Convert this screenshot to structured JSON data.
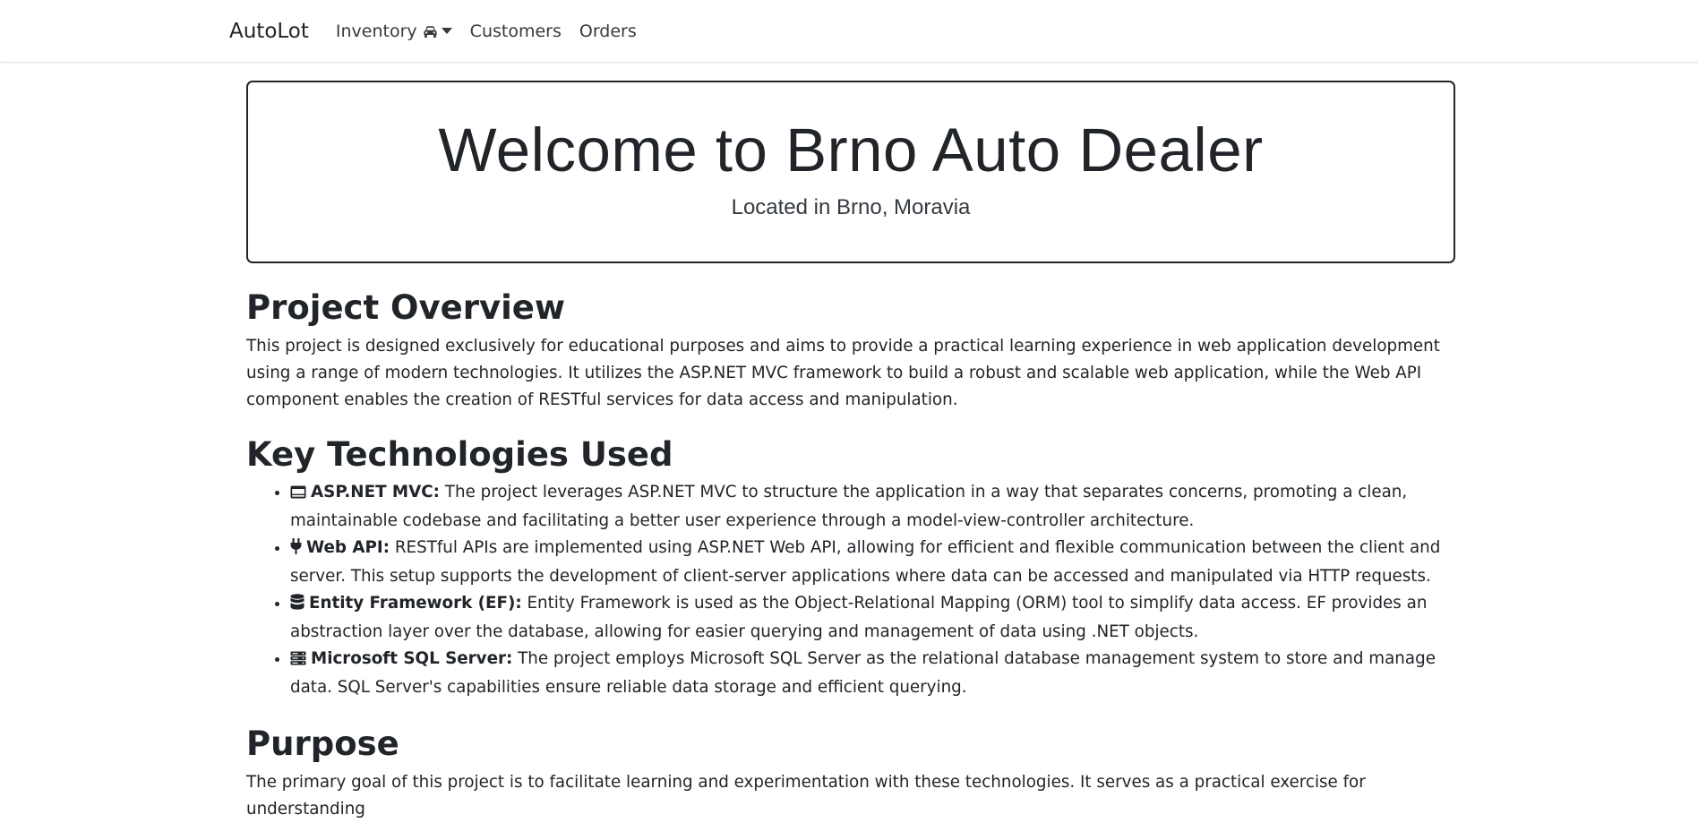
{
  "nav": {
    "brand": "AutoLot",
    "items": [
      {
        "label": "Inventory",
        "icon": "car-icon",
        "dropdown": true
      },
      {
        "label": "Customers"
      },
      {
        "label": "Orders"
      }
    ]
  },
  "hero": {
    "title": "Welcome to Brno Auto Dealer",
    "subtitle": "Located in Brno, Moravia"
  },
  "overview": {
    "heading": "Project Overview",
    "text": "This project is designed exclusively for educational purposes and aims to provide a practical learning experience in web application development using a range of modern technologies. It utilizes the ASP.NET MVC framework to build a robust and scalable web application, while the Web API component enables the creation of RESTful services for data access and manipulation."
  },
  "technologies": {
    "heading": "Key Technologies Used",
    "items": [
      {
        "icon": "window-icon",
        "title": "ASP.NET MVC:",
        "text": " The project leverages ASP.NET MVC to structure the application in a way that separates concerns, promoting a clean, maintainable codebase and facilitating a better user experience through a model-view-controller architecture."
      },
      {
        "icon": "plug-icon",
        "title": "Web API:",
        "text": " RESTful APIs are implemented using ASP.NET Web API, allowing for efficient and flexible communication between the client and server. This setup supports the development of client-server applications where data can be accessed and manipulated via HTTP requests."
      },
      {
        "icon": "database-icon",
        "title": "Entity Framework (EF):",
        "text": " Entity Framework is used as the Object-Relational Mapping (ORM) tool to simplify data access. EF provides an abstraction layer over the database, allowing for easier querying and management of data using .NET objects."
      },
      {
        "icon": "server-icon",
        "title": "Microsoft SQL Server:",
        "text": " The project employs Microsoft SQL Server as the relational database management system to store and manage data. SQL Server's capabilities ensure reliable data storage and efficient querying."
      }
    ]
  },
  "purpose": {
    "heading": "Purpose",
    "text": "The primary goal of this project is to facilitate learning and experimentation with these technologies. It serves as a practical exercise for understanding"
  }
}
